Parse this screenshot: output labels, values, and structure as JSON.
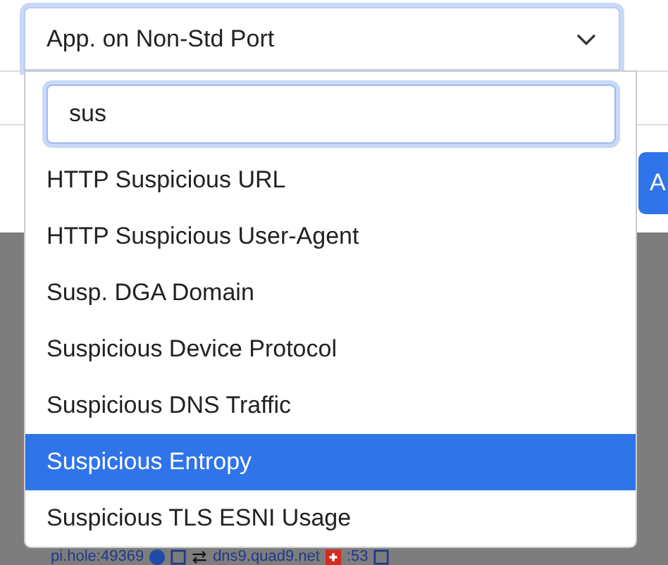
{
  "select": {
    "value": "App. on Non-Std Port",
    "expanded": true
  },
  "search": {
    "value": "sus"
  },
  "options": [
    {
      "label": "HTTP Suspicious URL",
      "selected": false
    },
    {
      "label": "HTTP Suspicious User-Agent",
      "selected": false
    },
    {
      "label": "Susp. DGA Domain",
      "selected": false
    },
    {
      "label": "Suspicious Device Protocol",
      "selected": false
    },
    {
      "label": "Suspicious DNS Traffic",
      "selected": false
    },
    {
      "label": "Suspicious Entropy",
      "selected": true
    },
    {
      "label": "Suspicious TLS ESNI Usage",
      "selected": false
    }
  ],
  "side_button": {
    "label": "A"
  },
  "flow": {
    "client": "pi.hole:49369",
    "server": "dns9.quad9.net",
    "port": ":53"
  }
}
